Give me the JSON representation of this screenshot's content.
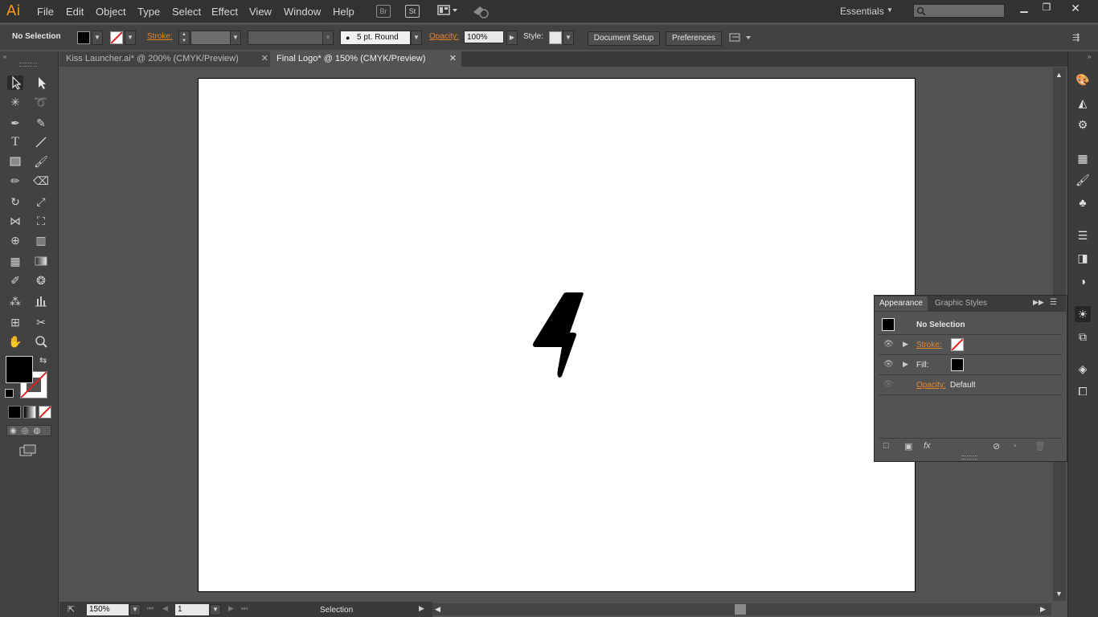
{
  "app": {
    "logo": "Ai"
  },
  "menu": [
    "File",
    "Edit",
    "Object",
    "Type",
    "Select",
    "Effect",
    "View",
    "Window",
    "Help"
  ],
  "topicons": {
    "bridge": "Br",
    "stock": "St"
  },
  "workspace": {
    "label": "Essentials"
  },
  "control": {
    "selection": "No Selection",
    "stroke_label": "Stroke:",
    "brush": "5 pt. Round",
    "opacity_label": "Opacity:",
    "opacity_value": "100%",
    "style_label": "Style:",
    "document_setup": "Document Setup",
    "preferences": "Preferences"
  },
  "tabs": [
    {
      "label": "Kiss Launcher.ai* @ 200% (CMYK/Preview)",
      "active": false
    },
    {
      "label": "Final Logo* @ 150% (CMYK/Preview)",
      "active": true
    }
  ],
  "appearance": {
    "tabs": [
      "Appearance",
      "Graphic Styles"
    ],
    "title": "No Selection",
    "stroke": "Stroke:",
    "fill": "Fill:",
    "opacity": "Opacity:",
    "opacity_value": "Default"
  },
  "status": {
    "zoom": "150%",
    "artboard": "1",
    "tool": "Selection"
  },
  "colors": {
    "accent_orange": "#e8862a",
    "logo_orange": "#ff9a00"
  }
}
